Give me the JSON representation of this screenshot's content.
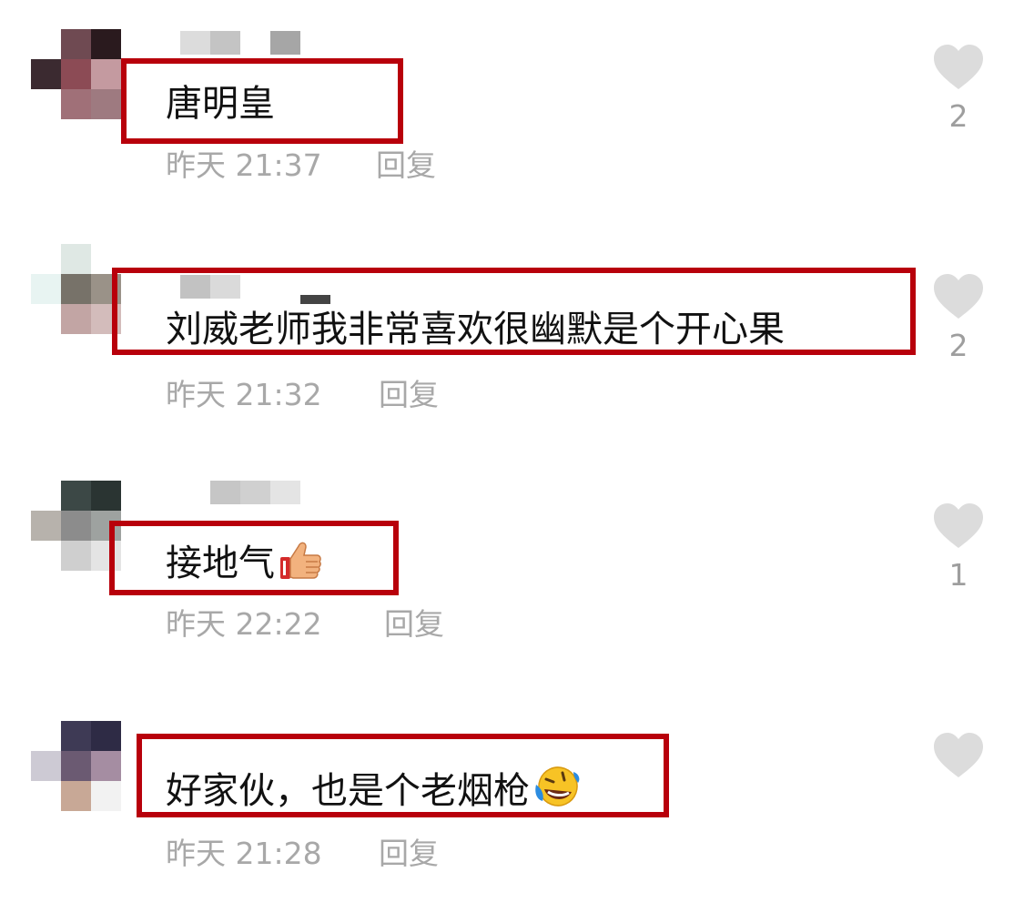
{
  "comments": [
    {
      "text": "唐明皇",
      "emoji": "",
      "time": "昨天 21:37",
      "reply": "回复",
      "likes": "2"
    },
    {
      "text": "刘威老师我非常喜欢很幽默是个开心果",
      "emoji": "",
      "time": "昨天 21:32",
      "reply": "回复",
      "likes": "2"
    },
    {
      "text": "接地气",
      "emoji": "thumbs-up",
      "time": "昨天 22:22",
      "reply": "回复",
      "likes": "1"
    },
    {
      "text": "好家伙，也是个老烟枪",
      "emoji": "rolling-laughing",
      "time": "昨天 21:28",
      "reply": "回复",
      "likes": ""
    }
  ],
  "colors": {
    "highlight_border": "#b8000b",
    "meta_gray": "#a8a8a8",
    "heart_gray": "#dcdcdc"
  }
}
